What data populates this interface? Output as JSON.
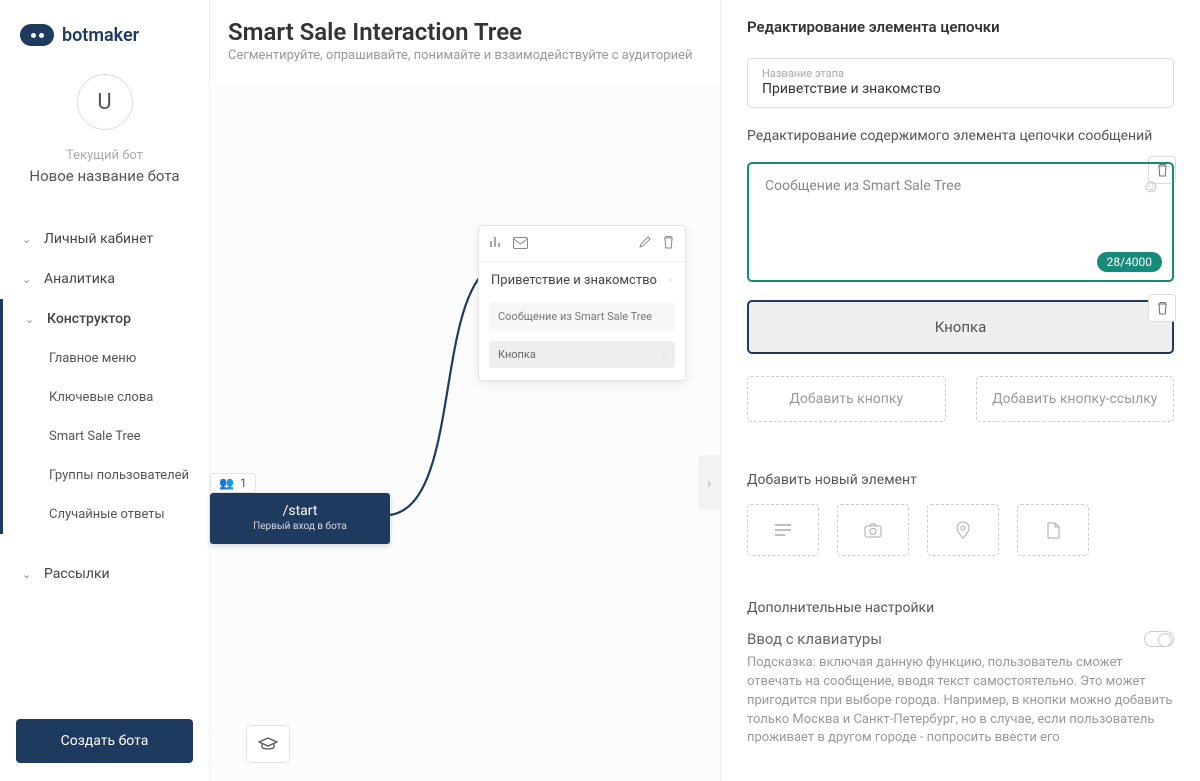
{
  "logo": {
    "text": "botmaker"
  },
  "user": {
    "initial": "U"
  },
  "current_bot": {
    "label": "Текущий бот",
    "name": "Новое название бота"
  },
  "nav": {
    "account": "Личный кабинет",
    "analytics": "Аналитика",
    "constructor": "Конструктор",
    "constructor_items": {
      "main_menu": "Главное меню",
      "keywords": "Ключевые слова",
      "smart_sale": "Smart Sale Tree",
      "user_groups": "Группы пользователей",
      "random_answers": "Случайные ответы"
    },
    "mailings": "Рассылки"
  },
  "create_bot": "Создать бота",
  "canvas_header": {
    "title": "Smart Sale Interaction Tree",
    "subtitle": "Сегментируйте, опрашивайте, понимайте и взаимодействуйте с аудиторией"
  },
  "start_node": {
    "count": "1",
    "command": "/start",
    "caption": "Первый вход в бота"
  },
  "card": {
    "title": "Приветствие и знакомство",
    "message": "Сообщение из Smart Sale Tree",
    "button": "Кнопка"
  },
  "panel": {
    "title": "Редактирование элемента цепочки",
    "stage_label": "Название этапа",
    "stage_value": "Приветствие и знакомство",
    "content_heading": "Редактирование содержимого элемента цепочки сообщений",
    "message_text": "Сообщение из Smart Sale Tree",
    "counter": "28/4000",
    "big_button": "Кнопка",
    "add_button": "Добавить кнопку",
    "add_link_button": "Добавить кнопку-ссылку",
    "add_element_title": "Добавить новый элемент",
    "extra_settings_title": "Дополнительные настройки",
    "keyboard_input_label": "Ввод с клавиатуры",
    "keyboard_hint": "Подсказка: включая данную функцию, пользователь сможет отвечать на сообщение, вводя текст самостоятельно. Это может пригодится при выборе города. Например, в кнопки можно добавить только Москва и Санкт-Петербург, но в случае, если пользователь проживает в другом городе - попросить ввести его"
  }
}
